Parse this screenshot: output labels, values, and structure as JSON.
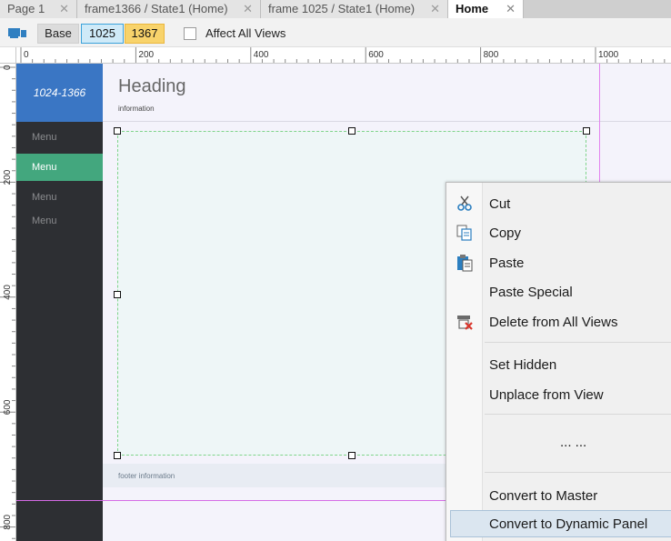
{
  "tabs": [
    {
      "label": "Page 1",
      "close": "✕"
    },
    {
      "label": "frame1366 / State1 (Home)",
      "close": "✕"
    },
    {
      "label": "frame 1025 / State1 (Home)",
      "close": "✕"
    },
    {
      "label": "Home",
      "close": "✕",
      "active": true
    }
  ],
  "toolbar": {
    "icon": "adaptive-views-icon",
    "views": [
      "Base",
      "1025",
      "1367"
    ],
    "affect_all_label": "Affect All Views",
    "affect_all_checked": false
  },
  "rulers": {
    "top_labels": [
      "0",
      "200",
      "400",
      "600",
      "800",
      "1000"
    ],
    "left_labels": [
      "0",
      "200",
      "400",
      "600",
      "800"
    ]
  },
  "canvas": {
    "sidebar_title": "1024-1366",
    "menu_items": [
      "Menu",
      "Menu",
      "Menu",
      "Menu"
    ],
    "active_menu_index": 1,
    "heading": "Heading",
    "information": "information",
    "footer": "footer information"
  },
  "context_menu": {
    "items": [
      {
        "label": "Cut",
        "icon": "scissors-icon"
      },
      {
        "label": "Copy",
        "icon": "copy-icon"
      },
      {
        "label": "Paste",
        "icon": "clipboard-icon"
      },
      {
        "label": "Paste Special",
        "icon": ""
      },
      {
        "label": "Delete from All Views",
        "icon": "delete-views-icon"
      },
      {
        "label": "Set Hidden",
        "icon": ""
      },
      {
        "label": "Unplace from View",
        "icon": ""
      },
      {
        "label": "... ...",
        "icon": ""
      },
      {
        "label": "Convert to Master",
        "icon": ""
      },
      {
        "label": "Convert to Dynamic Panel",
        "icon": "",
        "highlighted": true
      }
    ]
  },
  "colors": {
    "sidebar_bg": "#2d2f33",
    "sidebar_header": "#3a76c4",
    "active_menu": "#43a77e",
    "view_1025": "#cfeaf8",
    "view_1367": "#f8d36b",
    "guide": "#e283ef"
  }
}
